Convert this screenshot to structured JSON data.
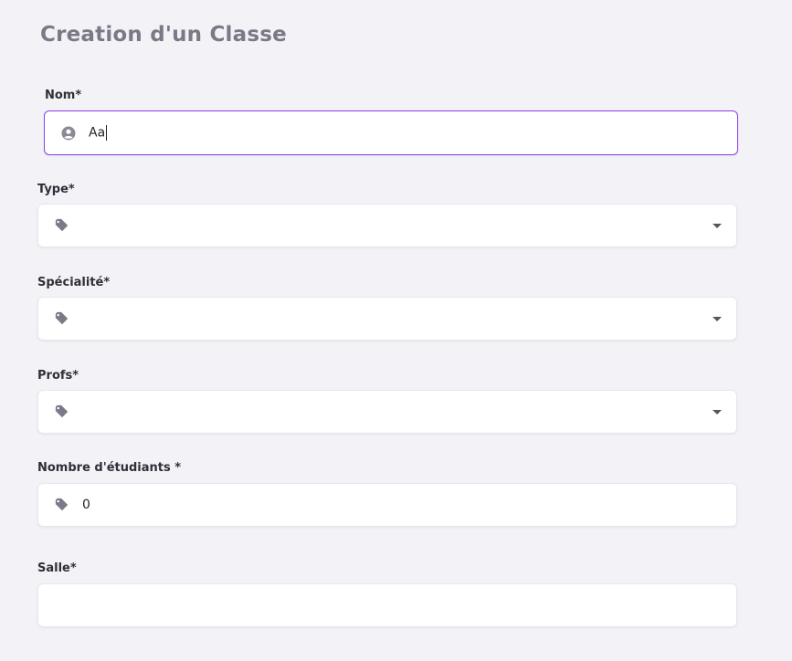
{
  "page": {
    "title": "Creation d'un Classe"
  },
  "form": {
    "nom": {
      "label": "Nom*",
      "value": "Aa",
      "icon": "user-circle-icon",
      "focus_color": "#8b3fe8"
    },
    "type": {
      "label": "Type*",
      "value": "",
      "icon": "tag-icon"
    },
    "specialite": {
      "label": "Spécialité*",
      "value": "",
      "icon": "tag-icon"
    },
    "profs": {
      "label": "Profs*",
      "value": "",
      "icon": "tag-icon"
    },
    "nombre_etudiants": {
      "label": "Nombre d'étudiants *",
      "value": "0",
      "icon": "tag-icon"
    },
    "salle": {
      "label": "Salle*",
      "value": ""
    }
  }
}
